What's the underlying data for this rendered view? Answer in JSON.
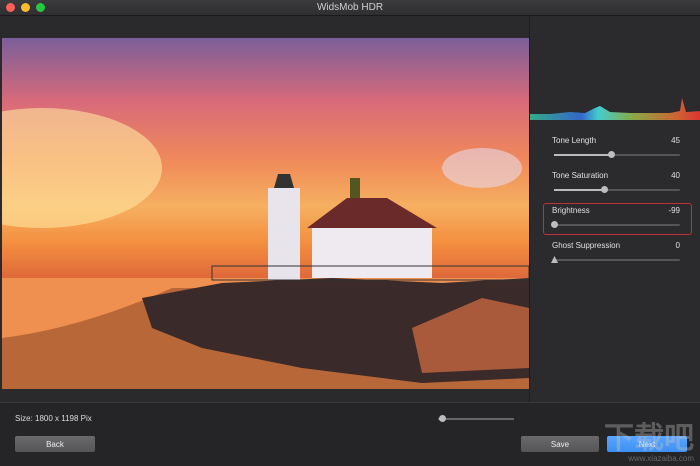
{
  "window": {
    "title": "WidsMob HDR"
  },
  "photo": {
    "size_label": "Size: 1800 x 1198 Pix",
    "zoom_fraction": 0.05
  },
  "adjustments": [
    {
      "label": "Tone Length",
      "value": "45",
      "fraction": 0.45
    },
    {
      "label": "Tone Saturation",
      "value": "40",
      "fraction": 0.4
    },
    {
      "label": "Brightness",
      "value": "-99",
      "fraction": 0.0,
      "highlighted": true
    },
    {
      "label": "Ghost Suppression",
      "value": "0",
      "fraction": 0.0
    }
  ],
  "buttons": {
    "back": "Back",
    "save": "Save",
    "next": "Next"
  },
  "colors": {
    "next": "#3d8ff0",
    "highlight": "#c0303a"
  },
  "watermark": {
    "text": "下载吧",
    "url": "www.xiazaiba.com"
  }
}
